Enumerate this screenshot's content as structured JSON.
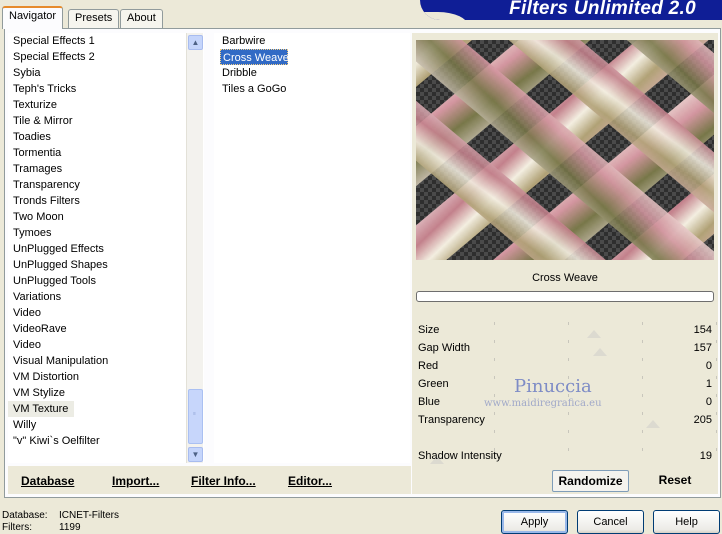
{
  "tabs": [
    {
      "label": "Navigator",
      "active": true
    },
    {
      "label": "Presets",
      "active": false
    },
    {
      "label": "About",
      "active": false
    }
  ],
  "banner": {
    "title": "Filters Unlimited 2.0"
  },
  "categories": [
    "Special Effects 1",
    "Special Effects 2",
    "Sybia",
    "Teph's Tricks",
    "Texturize",
    "Tile & Mirror",
    "Toadies",
    "Tormentia",
    "Tramages",
    "Transparency",
    "Tronds Filters",
    "Two Moon",
    "Tymoes",
    "UnPlugged Effects",
    "UnPlugged Shapes",
    "UnPlugged Tools",
    "Variations",
    "Video",
    "VideoRave",
    "Video",
    "Visual Manipulation",
    "VM Distortion",
    "VM Stylize",
    "VM Texture",
    "Willy",
    "\"v\" Kiwi`s Oelfilter"
  ],
  "selected_category": "VM Texture",
  "filters": [
    "Barbwire",
    "Cross Weave",
    "Dribble",
    "Tiles a GoGo"
  ],
  "selected_filter": "Cross Weave",
  "bottom_buttons": {
    "database": "Database",
    "import": "Import...",
    "filter_info": "Filter Info...",
    "editor": "Editor..."
  },
  "preview": {
    "filter_name": "Cross Weave"
  },
  "parameters": [
    {
      "label": "Size",
      "value": "154",
      "level": 0.6
    },
    {
      "label": "Gap Width",
      "value": "157",
      "level": 0.62
    },
    {
      "label": "Red",
      "value": "0",
      "level": 0
    },
    {
      "label": "Green",
      "value": "1",
      "level": 0
    },
    {
      "label": "Blue",
      "value": "0",
      "level": 0
    },
    {
      "label": "Transparency",
      "value": "205",
      "level": 0.8
    },
    {
      "label": "",
      "value": "",
      "level": 0
    },
    {
      "label": "Shadow Intensity",
      "value": "19",
      "level": 0.07
    }
  ],
  "watermark": {
    "name": "Pinuccia",
    "url": "www.maidiregrafica.eu"
  },
  "right_buttons": {
    "randomize": "Randomize",
    "reset": "Reset"
  },
  "status": {
    "database_label": "Database:",
    "database_value": "ICNET-Filters",
    "filters_label": "Filters:",
    "filters_value": "1199"
  },
  "dialog_buttons": {
    "apply": "Apply",
    "cancel": "Cancel",
    "help": "Help"
  },
  "colors": {
    "selection": "#316ac5",
    "banner": "#0f1e96",
    "tab_accent": "#e68b2c"
  }
}
